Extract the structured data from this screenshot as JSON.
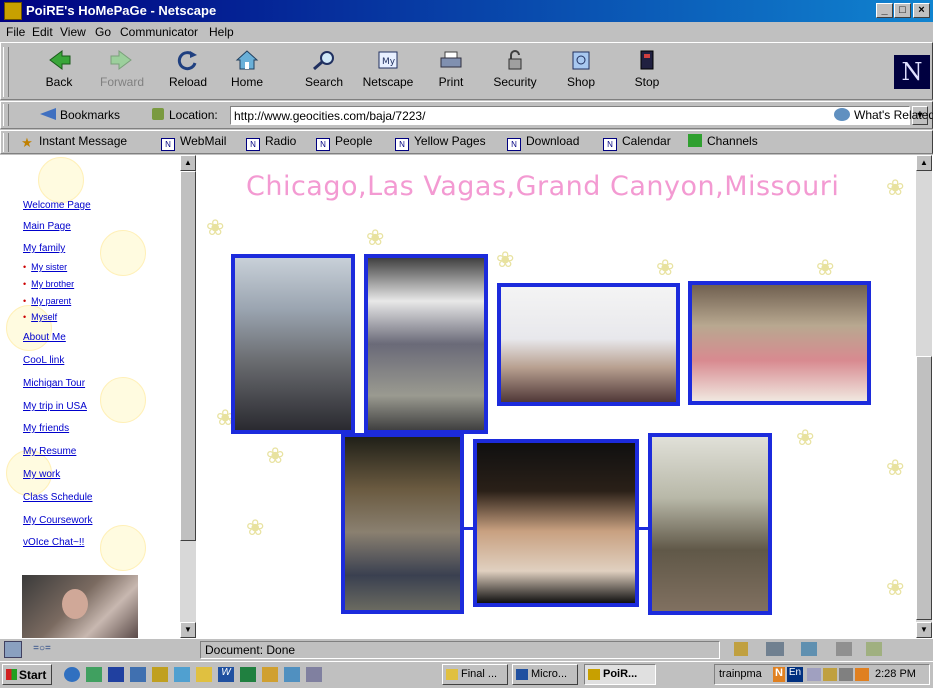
{
  "window": {
    "title": "PoiRE's HoMePaGe - Netscape",
    "buttons": [
      "_",
      "□",
      "×"
    ]
  },
  "menu": [
    "File",
    "Edit",
    "View",
    "Go",
    "Communicator",
    "Help"
  ],
  "toolbar": {
    "back": "Back",
    "forward": "Forward",
    "reload": "Reload",
    "home": "Home",
    "search": "Search",
    "netscape": "Netscape",
    "print": "Print",
    "security": "Security",
    "shop": "Shop",
    "stop": "Stop",
    "brand": "N"
  },
  "location": {
    "bookmarks_label": "Bookmarks",
    "location_label": "Location:",
    "url": "http://www.geocities.com/baja/7223/",
    "whats_related": "What's Related"
  },
  "personal_toolbar": {
    "instant_message": "Instant Message",
    "webmail": "WebMail",
    "radio": "Radio",
    "people": "People",
    "yellow_pages": "Yellow Pages",
    "download": "Download",
    "calendar": "Calendar",
    "channels": "Channels"
  },
  "sidebar": {
    "links": [
      {
        "label": "Welcome Page"
      },
      {
        "label": "Main Page"
      },
      {
        "label": "My family"
      }
    ],
    "family_sub": [
      {
        "label": "My sister"
      },
      {
        "label": "My brother"
      },
      {
        "label": "My parent"
      },
      {
        "label": "Myself"
      }
    ],
    "links2": [
      {
        "label": "About Me"
      },
      {
        "label": "CooL link"
      },
      {
        "label": "Michigan Tour"
      },
      {
        "label": "My trip in USA"
      },
      {
        "label": "My friends"
      },
      {
        "label": "My Resume"
      },
      {
        "label": "My work"
      },
      {
        "label": "Class Schedule"
      },
      {
        "label": "My Coursework"
      },
      {
        "label": "vOIce Chat~!!"
      }
    ]
  },
  "main": {
    "heading": "Chicago,Las Vagas,Grand Canyon,Missouri"
  },
  "status": {
    "text": "Document: Done"
  },
  "taskbar": {
    "start": "Start",
    "tasks": [
      "Final ...",
      "Micro...",
      "PoiR..."
    ],
    "tray_user": "trainpma",
    "tray_lang": "En",
    "clock": "2:28 PM"
  },
  "colors": {
    "title_bar": "#000080",
    "heading": "#f39ad2",
    "photo_border": "#1c2bdc",
    "link": "#0000cc"
  }
}
